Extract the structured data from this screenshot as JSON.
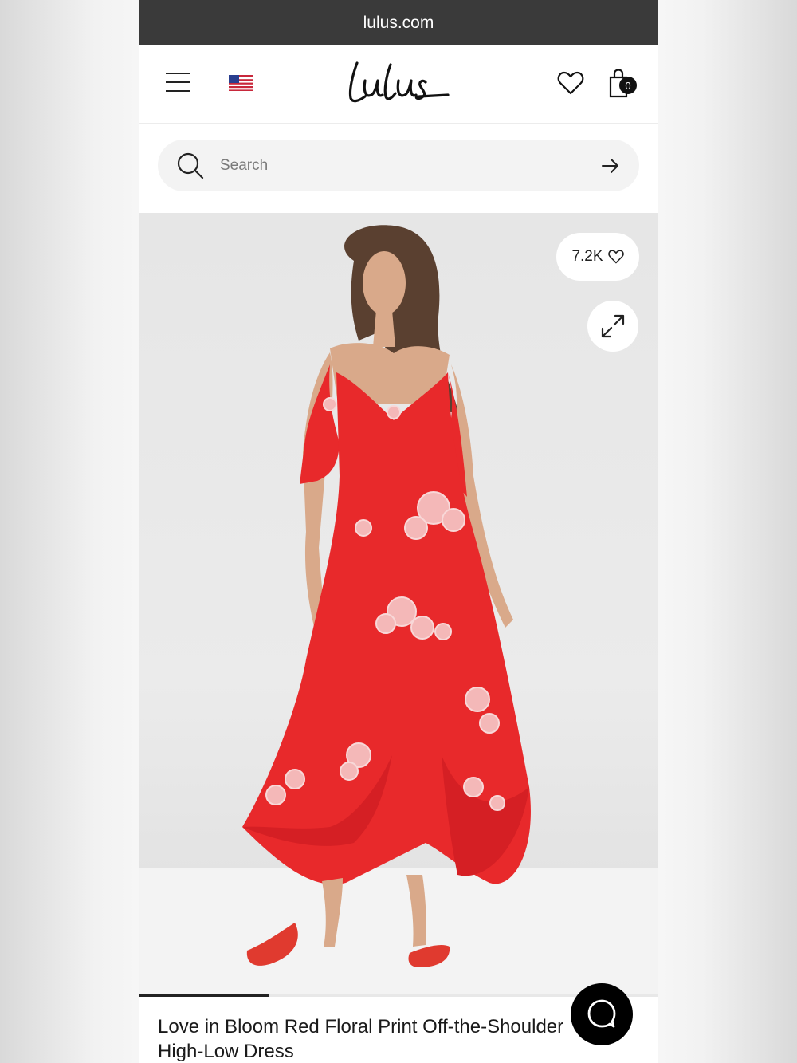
{
  "browser": {
    "url": "lulus.com"
  },
  "header": {
    "logo_text": "Lulus",
    "cart_count": "0",
    "icons": [
      "menu-icon",
      "us-flag-icon",
      "heart-icon",
      "shopping-bag-icon"
    ]
  },
  "search": {
    "placeholder": "Search"
  },
  "product": {
    "likes": "7.2K",
    "title_line1": "Love in Bloom Red Floral Print Off-the-Shoulder",
    "title_line2": "High-Low Dress",
    "image_progress": 0.25
  },
  "colors": {
    "dress": "#e8292b",
    "url_bar": "#3a3a3a",
    "chat_button": "#000000"
  }
}
